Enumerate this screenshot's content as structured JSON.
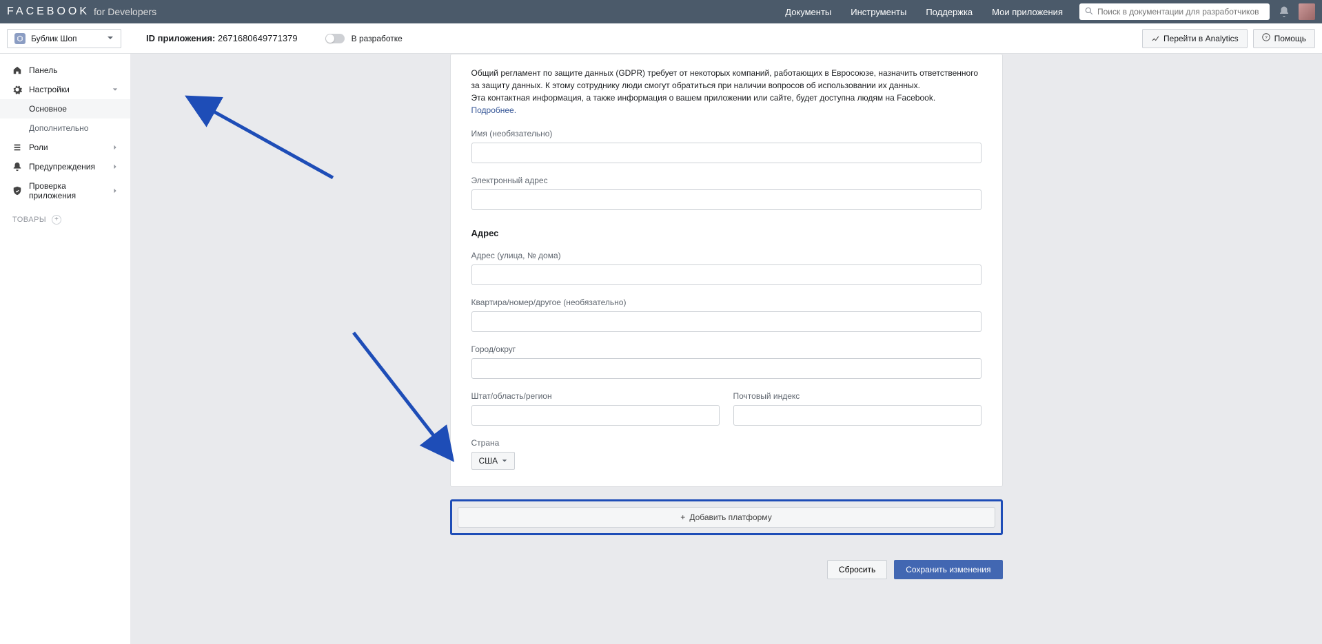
{
  "topnav": {
    "brand": "FACEBOOK",
    "brand_sub": "for Developers",
    "links": [
      "Документы",
      "Инструменты",
      "Поддержка",
      "Мои приложения"
    ],
    "search_placeholder": "Поиск в документации для разработчиков"
  },
  "subbar": {
    "app_name": "Бублик Шоп",
    "app_id_label": "ID приложения:",
    "app_id": "2671680649771379",
    "status_label": "В разработке",
    "analytics_label": "Перейти в Analytics",
    "help_label": "Помощь"
  },
  "sidebar": {
    "panel": "Панель",
    "settings": "Настройки",
    "settings_basic": "Основное",
    "settings_advanced": "Дополнительно",
    "roles": "Роли",
    "alerts": "Предупреждения",
    "app_review": "Проверка приложения",
    "products": "ТОВАРЫ"
  },
  "content": {
    "gdpr_text_1": "Общий регламент по защите данных (GDPR) требует от некоторых компаний, работающих в Евросоюзе, назначить ответственного за защиту данных. К этому сотруднику люди смогут обратиться при наличии вопросов об использовании их данных.",
    "gdpr_text_2": "Эта контактная информация, а также информация о вашем приложении или сайте, будет доступна людям на Facebook. ",
    "learn_more": "Подробнее.",
    "name_label": "Имя (необязательно)",
    "email_label": "Электронный адрес",
    "address_heading": "Адрес",
    "street_label": "Адрес (улица, № дома)",
    "apt_label": "Квартира/номер/другое (необязательно)",
    "city_label": "Город/округ",
    "state_label": "Штат/область/регион",
    "postal_label": "Почтовый индекс",
    "country_label": "Страна",
    "country_value": "США",
    "add_platform": "Добавить платформу",
    "reset": "Сбросить",
    "save": "Сохранить изменения"
  }
}
